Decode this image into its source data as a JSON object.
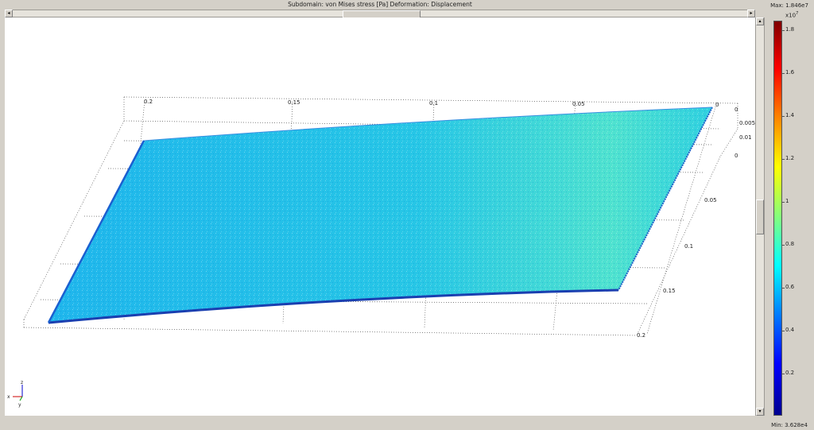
{
  "plot": {
    "title": "Subdomain: von Mises stress [Pa]   Deformation: Displacement"
  },
  "scrollbars": {
    "left_arrow": "◂",
    "right_arrow": "▸",
    "up_arrow": "▴",
    "down_arrow": "▾"
  },
  "axes": {
    "x_ticks": [
      "0.2",
      "0.15",
      "0.1",
      "0.05",
      "0"
    ],
    "z_ticks": [
      "0",
      "0.005",
      "0.01"
    ],
    "y_ticks": [
      "0",
      "0.05",
      "0.1",
      "0.15",
      "0.2"
    ],
    "triad": {
      "x": "x",
      "y": "y",
      "z": "z"
    }
  },
  "colorbar": {
    "max_label": "Max: 1.846e7",
    "exponent_base": "x10",
    "exponent_power": "7",
    "ticks": [
      "1.8",
      "1.6",
      "1.4",
      "1.2",
      "1",
      "0.8",
      "0.6",
      "0.4",
      "0.2"
    ],
    "tick_values": [
      1.8,
      1.6,
      1.4,
      1.2,
      1.0,
      0.8,
      0.6,
      0.4,
      0.2
    ],
    "range": [
      0.003628,
      1.846
    ],
    "min_label": "Min: 3.628e4",
    "colormap": [
      "#00008f",
      "#0000ff",
      "#0080ff",
      "#00ffff",
      "#80ff80",
      "#ffff00",
      "#ff8000",
      "#ff0000",
      "#800000"
    ]
  },
  "colors": {
    "plate_main": "#29c3e8",
    "plate_highlight": "#5fe8c8",
    "plate_edge": "#1a3fb0"
  }
}
